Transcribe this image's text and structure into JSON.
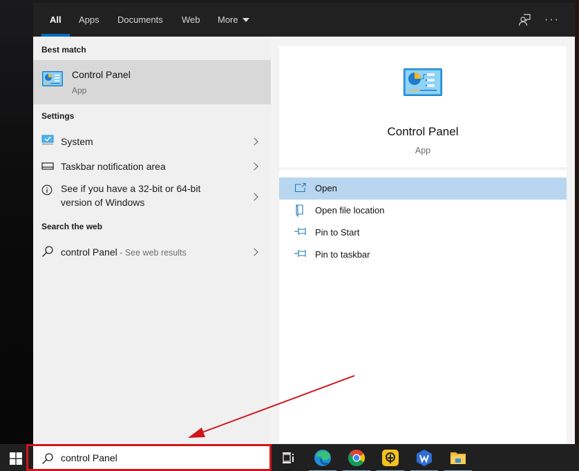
{
  "tabs": [
    {
      "label": "All",
      "active": true
    },
    {
      "label": "Apps",
      "active": false
    },
    {
      "label": "Documents",
      "active": false
    },
    {
      "label": "Web",
      "active": false
    },
    {
      "label": "More",
      "active": false,
      "has_dropdown": true
    }
  ],
  "toolbar_icons": [
    "feedback-icon",
    "more-options-icon"
  ],
  "more_options_glyph": "···",
  "left": {
    "best_match_header": "Best match",
    "best_match": {
      "title": "Control Panel",
      "subtitle": "App",
      "icon": "control-panel-icon"
    },
    "settings_header": "Settings",
    "settings": [
      {
        "label": "System",
        "icon": "monitor-icon"
      },
      {
        "label": "Taskbar notification area",
        "icon": "taskbar-icon"
      },
      {
        "label_line1": "See if you have a 32-bit or 64-bit",
        "label_line2": "version of Windows",
        "icon": "info-icon"
      }
    ],
    "web_header": "Search the web",
    "web_result": {
      "query": "control Panel",
      "suffix": " - See web results",
      "icon": "search-icon"
    }
  },
  "detail": {
    "title": "Control Panel",
    "subtitle": "App",
    "actions": [
      {
        "label": "Open",
        "icon": "open-icon",
        "active": true
      },
      {
        "label": "Open file location",
        "icon": "file-location-icon",
        "active": false
      },
      {
        "label": "Pin to Start",
        "icon": "pin-icon",
        "active": false
      },
      {
        "label": "Pin to taskbar",
        "icon": "pin-icon",
        "active": false
      }
    ]
  },
  "taskbar": {
    "search_value": "control Panel",
    "apps": [
      "task-view",
      "edge",
      "chrome",
      "lightpdf",
      "wps-office",
      "file-explorer"
    ]
  },
  "colors": {
    "accent": "#0a6dc2",
    "selected_action": "#b8d6ef",
    "annotation_red": "#d0161b"
  }
}
